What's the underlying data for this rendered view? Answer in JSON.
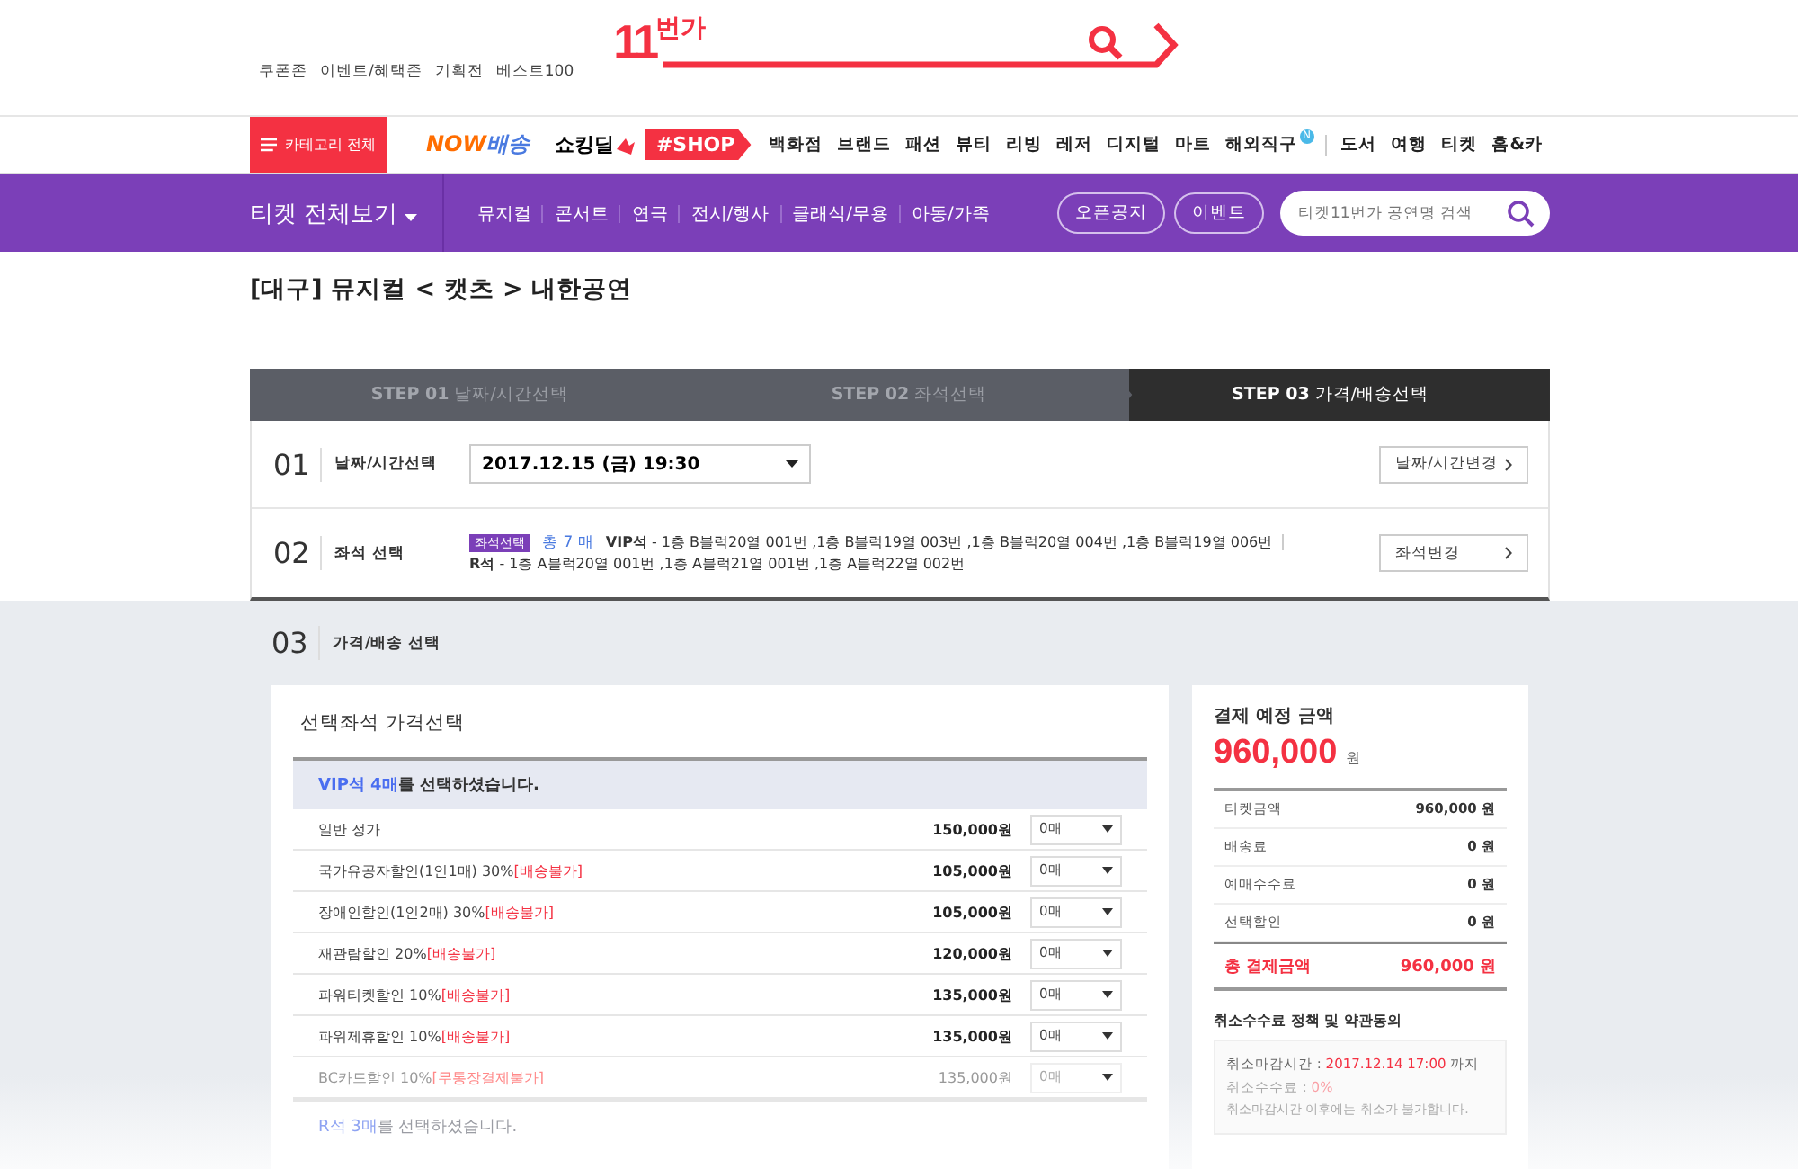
{
  "top_links": [
    "쿠폰존",
    "이벤트/혜택존",
    "기획전",
    "베스트100"
  ],
  "logo": {
    "number": "11",
    "word": "번가"
  },
  "category_button": "카테고리 전체",
  "brands": {
    "now": [
      "NOW",
      "배송"
    ],
    "deal": "쇼킹딜"
  },
  "shop_badge": "#SHOP",
  "shop_menu": [
    {
      "label": "백화점"
    },
    {
      "label": "브랜드"
    },
    {
      "label": "패션"
    },
    {
      "label": "뷰티"
    },
    {
      "label": "리빙"
    },
    {
      "label": "레저"
    },
    {
      "label": "디지털"
    },
    {
      "label": "마트"
    },
    {
      "label": "해외직구",
      "badge": "N"
    }
  ],
  "extra_menu": [
    "도서",
    "여행",
    "티켓",
    "홈&카"
  ],
  "ticket_nav": {
    "all": "티켓 전체보기",
    "items": [
      "뮤지컬",
      "콘서트",
      "연극",
      "전시/행사",
      "클래식/무용",
      "아동/가족"
    ],
    "buttons": [
      "오픈공지",
      "이벤트"
    ],
    "search": {
      "placeholder": "티켓11번가 공연명 검색"
    }
  },
  "page_title": "[대구] 뮤지컬 < 캣츠 > 내한공연",
  "steps": [
    {
      "number": "STEP 01",
      "label": "날짜/시간선택",
      "selected": false
    },
    {
      "number": "STEP 02",
      "label": "좌석선택",
      "selected": false
    },
    {
      "number": "STEP 03",
      "label": "가격/배송선택",
      "selected": true
    }
  ],
  "date_row": {
    "number": "01",
    "label": "날짜/시간선택",
    "value": "2017.12.15 (금) 19:30",
    "button": "날짜/시간변경"
  },
  "seat_row": {
    "number": "02",
    "label": "좌석 선택",
    "tag": "좌석선택",
    "count": "총 7 매",
    "groups": [
      "**VIP석** - 1층 B블럭20열 001번 ,1층 B블럭19열 003번 ,1층 B블럭20열 004번 ,1층 B블럭19열 006번",
      "**R석** - 1층 A블럭20열 001번 ,1층 A블럭21열 001번 ,1층 A블럭22열 002번"
    ],
    "button": "좌석변경"
  },
  "price_section": {
    "number": "03",
    "label": "가격/배송 선택",
    "card_title": "선택좌석 가격선택",
    "groups": [
      {
        "grade": "VIP석 4매",
        "suffix": "를 선택하셨습니다.",
        "rows": [
          {
            "name": "일반 정가",
            "price": "150,000원",
            "qty": "0매",
            "disabled": false
          },
          {
            "name": "국가유공자할인(1인1매) 30%",
            "note": "[배송불가]",
            "price": "105,000원",
            "qty": "0매",
            "disabled": false
          },
          {
            "name": "장애인할인(1인2매) 30%",
            "note": "[배송불가]",
            "price": "105,000원",
            "qty": "0매",
            "disabled": false
          },
          {
            "name": "재관람할인 20%",
            "note": "[배송불가]",
            "price": "120,000원",
            "qty": "0매",
            "disabled": false
          },
          {
            "name": "파워티켓할인 10%",
            "note": "[배송불가]",
            "price": "135,000원",
            "qty": "0매",
            "disabled": false
          },
          {
            "name": "파워제휴할인 10%",
            "note": "[배송불가]",
            "price": "135,000원",
            "qty": "0매",
            "disabled": false
          },
          {
            "name": "BC카드할인 10%",
            "note": "[무통장결제불가]",
            "price": "135,000원",
            "qty": "0매",
            "disabled": true
          }
        ]
      },
      {
        "grade": "R석 3매",
        "suffix": "를 선택하셨습니다."
      }
    ]
  },
  "payment": {
    "title": "결제 예정 금액",
    "amount": "960,000",
    "unit": "원",
    "lines": [
      {
        "label": "티켓금액",
        "value": "960,000 원"
      },
      {
        "label": "배송료",
        "value": "0 원"
      },
      {
        "label": "예매수수료",
        "value": "0 원"
      },
      {
        "label": "선택할인",
        "value": "0 원"
      }
    ],
    "total": {
      "label": "총 결제금액",
      "value": "960,000 원"
    },
    "policy_title": "취소수수료 정책 및 약관동의",
    "policy": [
      {
        "label": "취소마감시간 : ",
        "value": "2017.12.14 17:00",
        "tail": " 까지"
      },
      {
        "label": "취소수수료 : ",
        "value": "0%"
      },
      {
        "label": "취소마감시간 이후에는 취소가 불가합니다."
      }
    ]
  }
}
